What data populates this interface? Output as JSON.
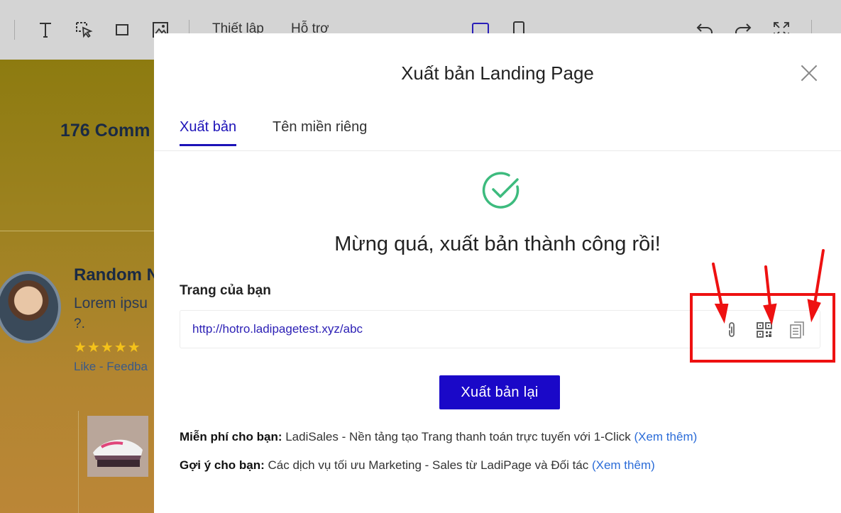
{
  "toolbar": {
    "menu_settings": "Thiết lập",
    "menu_support": "Hỗ trợ",
    "icons": [
      "text-icon",
      "select-icon",
      "rectangle-icon",
      "image-icon",
      "desktop-view-icon",
      "mobile-view-icon",
      "undo-icon",
      "redo-icon",
      "fullscreen-icon"
    ]
  },
  "canvas": {
    "heading": "176 Comm",
    "review_name": "Random N",
    "review_text": "Lorem ipsu",
    "review_text2": "?.",
    "stars": "★★★★★",
    "review_links": "Like - Feedba"
  },
  "modal": {
    "title": "Xuất bản Landing Page",
    "tabs": [
      {
        "label": "Xuất bản",
        "active": true
      },
      {
        "label": "Tên miền riêng",
        "active": false
      }
    ],
    "success_message": "Mừng quá, xuất bản thành công rồi!",
    "url_label": "Trang của bạn",
    "url": "http://hotro.ladipagetest.xyz/abc",
    "url_actions": [
      "link-icon",
      "qr-code-icon",
      "copy-icon"
    ],
    "republish_label": "Xuất bản lại",
    "promo1": {
      "bold": "Miễn phí cho bạn:",
      "text": " LadiSales - Nền tảng tạo Trang thanh toán trực tuyến với 1-Click ",
      "link": "(Xem thêm)"
    },
    "promo2": {
      "bold": "Gợi ý cho bạn:",
      "text": " Các dịch vụ tối ưu Marketing - Sales từ LadiPage và Đối tác ",
      "link": "(Xem thêm)"
    }
  },
  "colors": {
    "primary": "#1a08c8",
    "active_tab": "#1c12b8",
    "success": "#3dbb7e",
    "link": "#2b6cd8",
    "annotation": "#ee1111"
  }
}
